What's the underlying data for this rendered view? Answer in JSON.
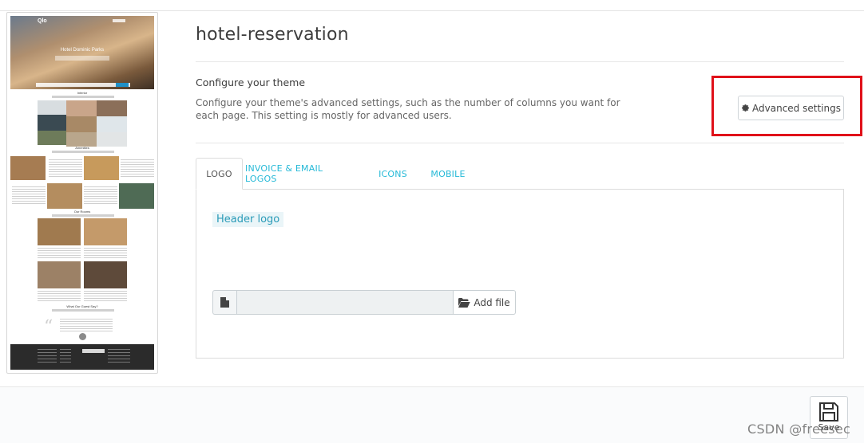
{
  "theme": {
    "name": "hotel-reservation",
    "preview": {
      "logo": "Qlo",
      "hero_title": "Hotel Dominic Parks",
      "sections": [
        "Interior",
        "Amenities",
        "Our Rooms",
        "What Our Guest Say?"
      ]
    }
  },
  "configure": {
    "heading": "Configure your theme",
    "description": "Configure your theme's advanced settings, such as the number of columns you want for each page. This setting is mostly for advanced users.",
    "advanced_button": "Advanced settings"
  },
  "tabs": [
    {
      "label": "LOGO",
      "active": true
    },
    {
      "label": "INVOICE & EMAIL LOGOS",
      "active": false
    },
    {
      "label": "ICONS",
      "active": false
    },
    {
      "label": "MOBILE",
      "active": false
    }
  ],
  "logo_panel": {
    "label": "Header logo",
    "file_value": "",
    "add_file_button": "Add file"
  },
  "footer": {
    "save_button": "Save"
  },
  "watermark": "CSDN @freesec",
  "colors": {
    "accent": "#25b9d7",
    "highlight": "#e0111a"
  }
}
